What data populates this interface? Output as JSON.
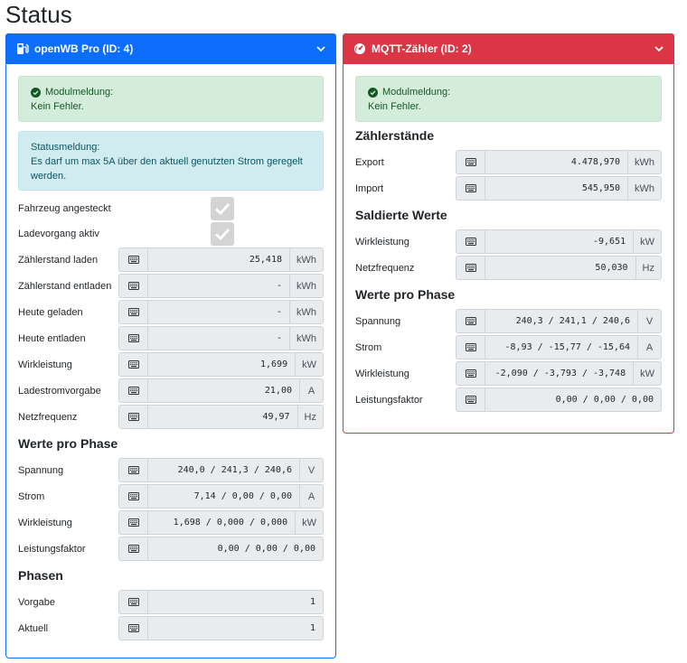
{
  "page": {
    "title": "Status"
  },
  "colors": {
    "left_accent": "#0d6efd",
    "right_accent": "#dc3545"
  },
  "left": {
    "header": {
      "icon": "charge-station-icon",
      "title": "openWB Pro (ID: 4)"
    },
    "module_alert": {
      "line1": "Modulmeldung:",
      "line2": "Kein Fehler."
    },
    "status_alert": {
      "line1": "Statusmeldung:",
      "line2": "Es darf um max 5A über den aktuell genutzten Strom geregelt werden."
    },
    "checks": [
      {
        "label": "Fahrzeug angesteckt"
      },
      {
        "label": "Ladevorgang aktiv"
      }
    ],
    "fields": [
      {
        "label": "Zählerstand laden",
        "value": "25,418",
        "unit": "kWh"
      },
      {
        "label": "Zählerstand entladen",
        "value": "-",
        "unit": "kWh"
      },
      {
        "label": "Heute geladen",
        "value": "-",
        "unit": "kWh"
      },
      {
        "label": "Heute entladen",
        "value": "-",
        "unit": "kWh"
      },
      {
        "label": "Wirkleistung",
        "value": "1,699",
        "unit": "kW"
      },
      {
        "label": "Ladestromvorgabe",
        "value": "21,00",
        "unit": "A"
      },
      {
        "label": "Netzfrequenz",
        "value": "49,97",
        "unit": "Hz"
      }
    ],
    "phase_title": "Werte pro Phase",
    "phase_fields": [
      {
        "label": "Spannung",
        "value": "240,0 / 241,3 / 240,6",
        "unit": "V"
      },
      {
        "label": "Strom",
        "value": "7,14 / 0,00 / 0,00",
        "unit": "A"
      },
      {
        "label": "Wirkleistung",
        "value": "1,698 / 0,000 / 0,000",
        "unit": "kW"
      },
      {
        "label": "Leistungsfaktor",
        "value": "0,00 / 0,00 / 0,00",
        "unit": ""
      }
    ],
    "phasen_title": "Phasen",
    "phasen_fields": [
      {
        "label": "Vorgabe",
        "value": "1"
      },
      {
        "label": "Aktuell",
        "value": "1"
      }
    ]
  },
  "right": {
    "header": {
      "icon": "meter-gauge-icon",
      "title": "MQTT-Zähler (ID: 2)"
    },
    "module_alert": {
      "line1": "Modulmeldung:",
      "line2": "Kein Fehler."
    },
    "counter_title": "Zählerstände",
    "counter_fields": [
      {
        "label": "Export",
        "value": "4.478,970",
        "unit": "kWh"
      },
      {
        "label": "Import",
        "value": "545,950",
        "unit": "kWh"
      }
    ],
    "saldiert_title": "Saldierte Werte",
    "saldiert_fields": [
      {
        "label": "Wirkleistung",
        "value": "-9,651",
        "unit": "kW"
      },
      {
        "label": "Netzfrequenz",
        "value": "50,030",
        "unit": "Hz"
      }
    ],
    "phase_title": "Werte pro Phase",
    "phase_fields": [
      {
        "label": "Spannung",
        "value": "240,3 / 241,1 / 240,6",
        "unit": "V"
      },
      {
        "label": "Strom",
        "value": "-8,93 / -15,77 / -15,64",
        "unit": "A"
      },
      {
        "label": "Wirkleistung",
        "value": "-2,090 / -3,793 / -3,748",
        "unit": "kW"
      },
      {
        "label": "Leistungsfaktor",
        "value": "0,00 / 0,00 / 0,00",
        "unit": ""
      }
    ]
  }
}
